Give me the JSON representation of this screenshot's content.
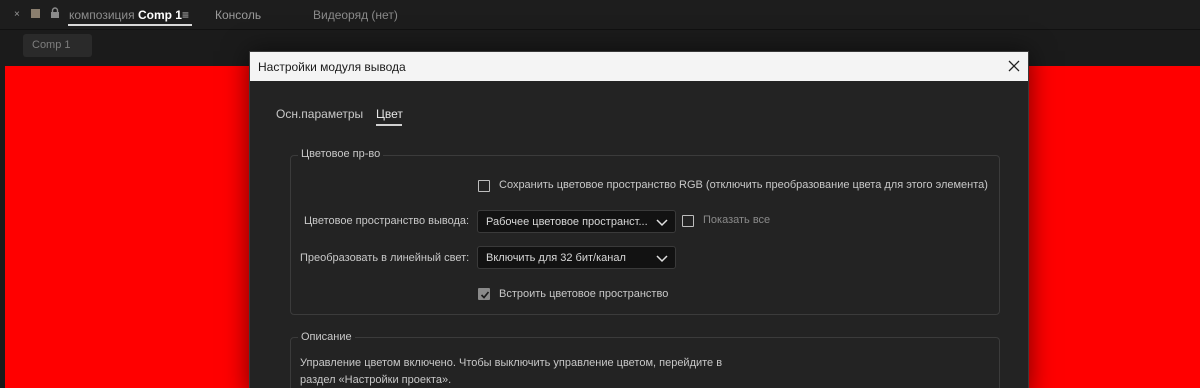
{
  "panel": {
    "close_glyph": "×",
    "comp_tab_prefix": "композиция",
    "comp_tab_name": "Comp 1",
    "menu_glyph": "≡",
    "console_tab": "Консоль",
    "footage_tab": "Видеоряд (нет)",
    "comp_chip": "Comp 1"
  },
  "viewer": {
    "background": "#ff0000"
  },
  "dialog": {
    "title": "Настройки модуля вывода",
    "tabs": [
      {
        "label": "Осн.параметры",
        "active": false
      },
      {
        "label": "Цвет",
        "active": true
      }
    ],
    "color_space_group": {
      "title": "Цветовое пр-во",
      "preserve_rgb": {
        "label": "Сохранить цветовое пространство RGB (отключить преобразование цвета для этого элемента)",
        "checked": false
      },
      "output_space": {
        "label": "Цветовое пространство вывода:",
        "value": "Рабочее цветовое пространст..."
      },
      "show_all": {
        "label": "Показать все",
        "checked": false
      },
      "linearize": {
        "label": "Преобразовать в линейный свет:",
        "value": "Включить для 32 бит/канал"
      },
      "embed": {
        "label": "Встроить цветовое пространство",
        "checked": true
      }
    },
    "description_group": {
      "title": "Описание",
      "line1": "Управление цветом включено. Чтобы выключить управление цветом, перейдите в",
      "line2": "раздел «Настройки проекта»."
    }
  }
}
